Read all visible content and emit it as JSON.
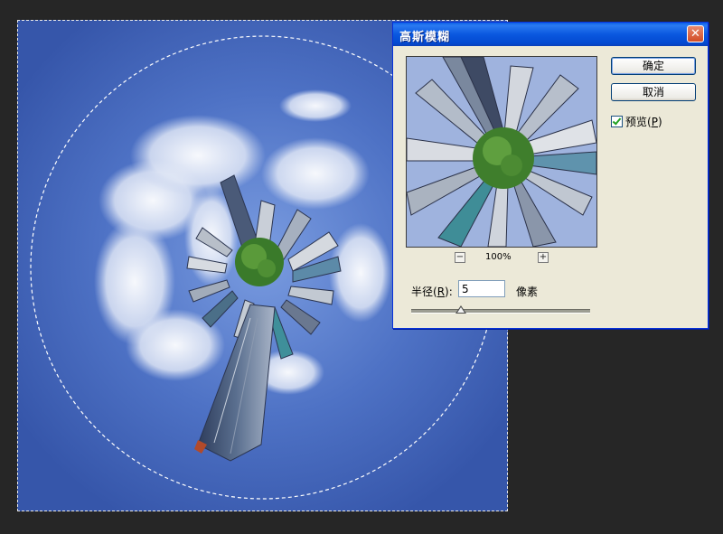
{
  "dialog": {
    "title": "高斯模糊",
    "ok_label": "确定",
    "cancel_label": "取消",
    "preview_label": "预览(",
    "preview_key": "P",
    "preview_suffix": ")",
    "preview_checked": true,
    "zoom_level": "100%",
    "zoom_out_symbol": "−",
    "zoom_in_symbol": "+",
    "radius_label": "半径(",
    "radius_key": "R",
    "radius_suffix": "):",
    "radius_value": "5",
    "radius_unit": "像素",
    "close_symbol": "✕"
  },
  "colors": {
    "sky": "#4f74c6",
    "titlebar": "#0a58df",
    "dialog_bg": "#ece9d8",
    "close_button": "#d24c26"
  }
}
